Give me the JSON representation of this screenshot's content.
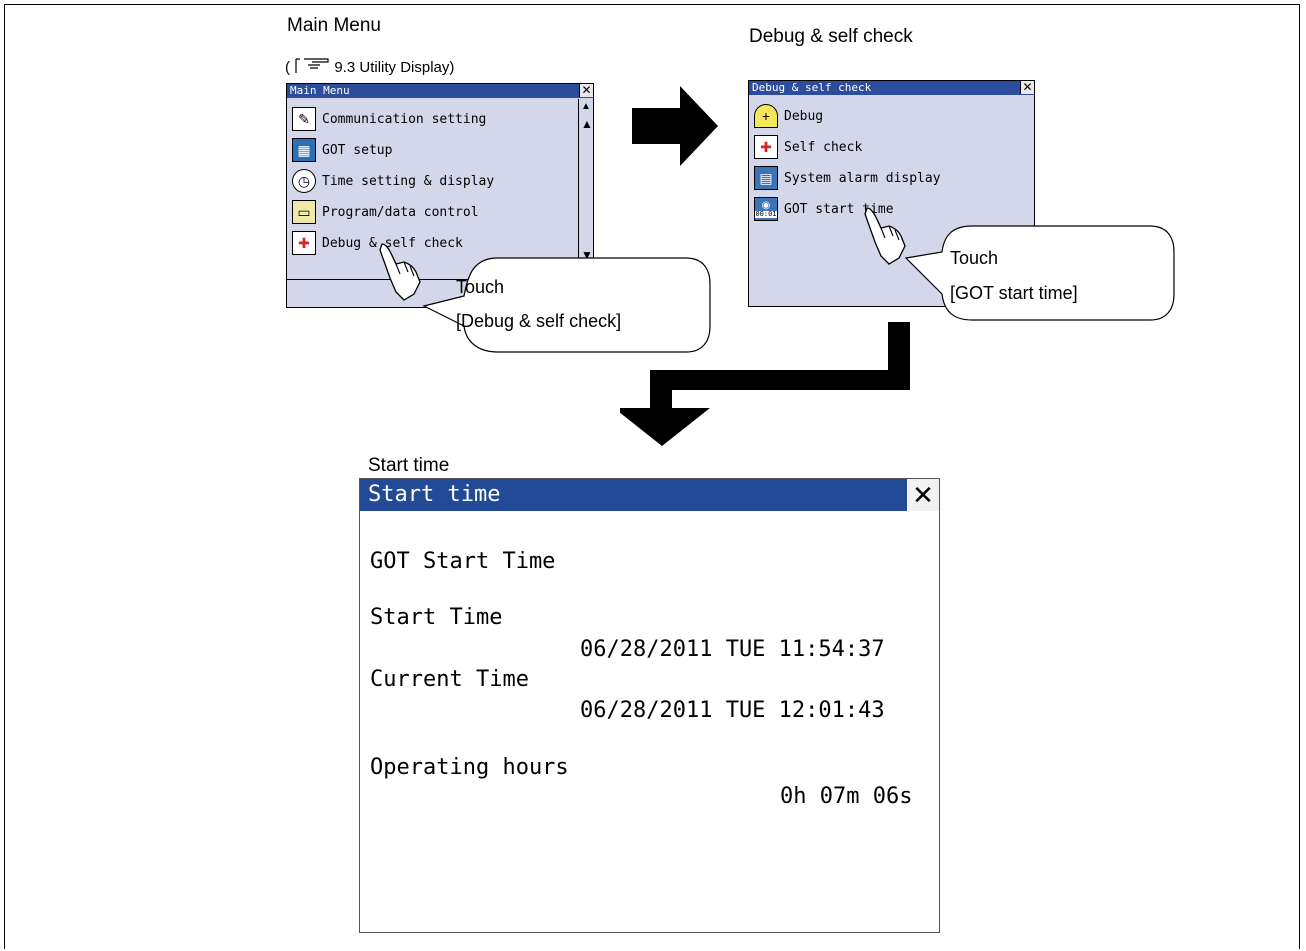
{
  "captions": {
    "main_menu": "Main Menu",
    "reference": "9.3 Utility Display)",
    "reference_open": "(",
    "debug_self_check": "Debug & self check",
    "start_time": "Start time"
  },
  "main_menu_window": {
    "title": "Main Menu",
    "close": "✕",
    "items": [
      {
        "label": "Communication setting",
        "icon": "communication-icon"
      },
      {
        "label": "GOT setup",
        "icon": "got-setup-icon"
      },
      {
        "label": "Time setting & display",
        "icon": "clock-icon"
      },
      {
        "label": "Program/data control",
        "icon": "folder-icon"
      },
      {
        "label": "Debug & self check",
        "icon": "debug-icon"
      }
    ]
  },
  "debug_window": {
    "title": "Debug & self check",
    "close": "✕",
    "items": [
      {
        "label": "Debug",
        "icon": "debug-icon"
      },
      {
        "label": "Self check",
        "icon": "self-check-icon"
      },
      {
        "label": "System alarm display",
        "icon": "system-alarm-icon"
      },
      {
        "label": "GOT start time",
        "icon": "start-time-icon",
        "badge": "00:01"
      }
    ]
  },
  "callouts": {
    "touch_debug_line1": "Touch",
    "touch_debug_line2": "[Debug & self check]",
    "touch_start_line1": "Touch",
    "touch_start_line2": "[GOT start time]"
  },
  "start_time_window": {
    "title": "Start time",
    "close": "✕",
    "heading": "GOT Start Time",
    "start_label": "Start Time",
    "start_value": "06/28/2011 TUE 11:54:37",
    "current_label": "Current Time",
    "current_value": "06/28/2011 TUE 12:01:43",
    "operating_label": "Operating hours",
    "operating_value": "0h 07m 06s"
  },
  "colors": {
    "titlebar": "#234a96",
    "window_bg": "#d4d7ea",
    "arrow": "#000000"
  }
}
